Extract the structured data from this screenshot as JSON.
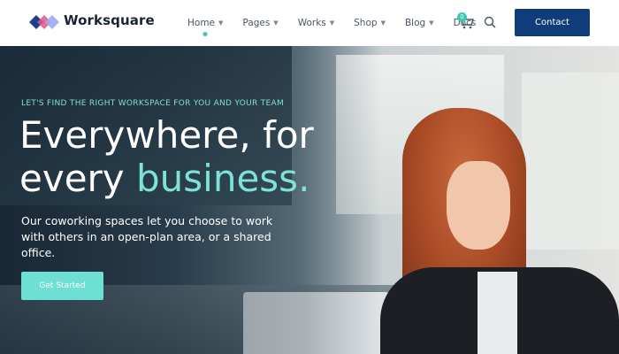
{
  "header": {
    "brand": "Worksquare",
    "nav": [
      {
        "label": "Home",
        "has_dropdown": true,
        "active": true
      },
      {
        "label": "Pages",
        "has_dropdown": true
      },
      {
        "label": "Works",
        "has_dropdown": true
      },
      {
        "label": "Shop",
        "has_dropdown": true
      },
      {
        "label": "Blog",
        "has_dropdown": true
      },
      {
        "label": "Docs",
        "has_dropdown": false
      }
    ],
    "cart_count": "0",
    "contact_label": "Contact",
    "icons": {
      "logo": "worksquare-logo-icon",
      "cart": "cart-icon",
      "search": "search-icon"
    }
  },
  "hero": {
    "eyebrow": "LET'S FIND THE RIGHT WORKSPACE FOR YOU AND YOUR TEAM",
    "headline_line1": "Everywhere, for",
    "headline_line2_plain": "every ",
    "headline_line2_accent": "business.",
    "subtext": "Our coworking spaces let you choose to work with others in an open-plan area, or a shared office.",
    "cta_label": "Get Started"
  },
  "colors": {
    "accent": "#3cc6b8",
    "primary": "#0f3d7a",
    "cta": "#6ee0d3"
  }
}
